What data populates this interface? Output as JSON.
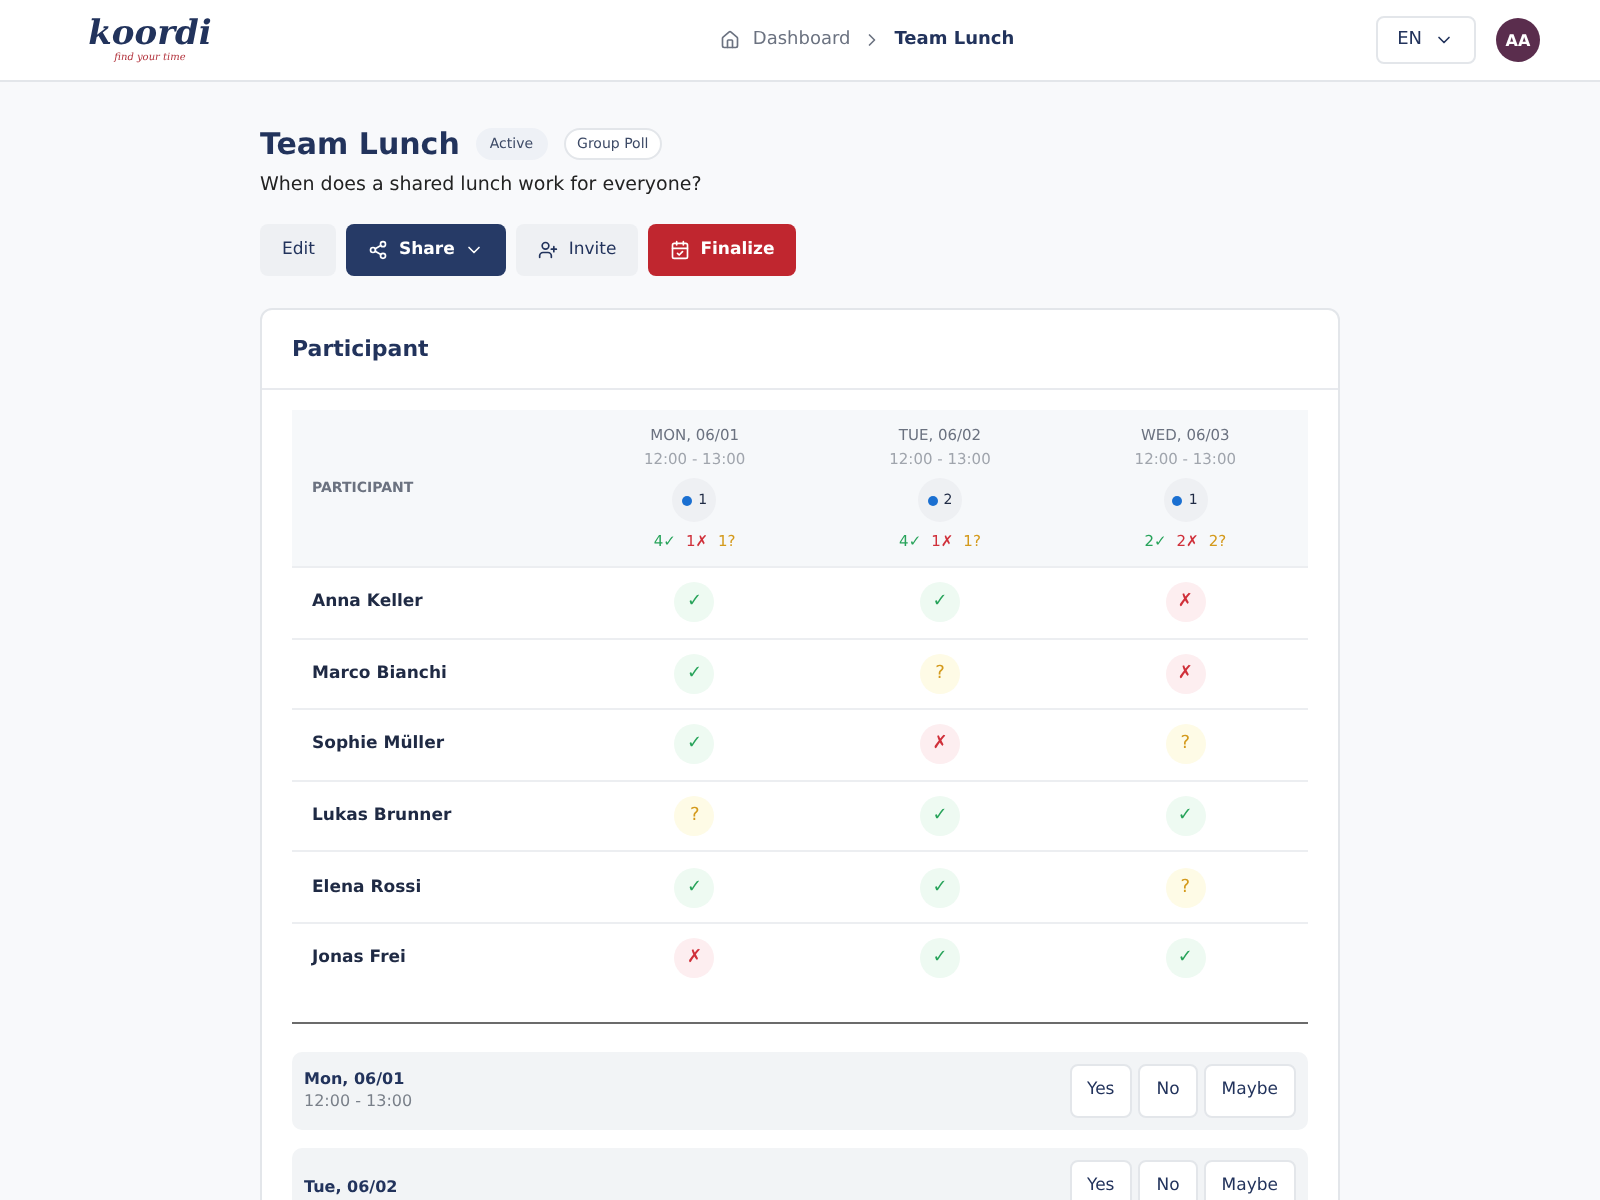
{
  "header": {
    "logo": "koordi",
    "tagline": "find your time",
    "breadcrumb": [
      {
        "label": "Dashboard",
        "current": false
      },
      {
        "label": "Team Lunch",
        "current": true
      }
    ],
    "language": "EN",
    "avatar": "AA"
  },
  "poll": {
    "title": "Team Lunch",
    "badges": [
      {
        "label": "Active",
        "kind": "status"
      },
      {
        "label": "Group Poll",
        "kind": "type"
      }
    ],
    "description": "When does a shared lunch work for everyone?",
    "actions": [
      {
        "label": "Edit",
        "kind": "plain"
      },
      {
        "label": "Share",
        "kind": "primary"
      },
      {
        "label": "Invite",
        "kind": "invite"
      },
      {
        "label": "Finalize",
        "kind": "danger"
      }
    ]
  },
  "card": {
    "title": "Participant"
  },
  "table": {
    "participant_heading": "PARTICIPANT",
    "columns": [
      {
        "day": "MON, 06/01",
        "time": "12:00 - 13:00",
        "count": "1",
        "color": "#1a6fd1",
        "summary": [
          {
            "kind": "yes",
            "text": "4✓"
          },
          {
            "kind": "no",
            "text": "1✗"
          },
          {
            "kind": "maybe",
            "text": "1?"
          }
        ]
      },
      {
        "day": "TUE, 06/02",
        "time": "12:00 - 13:00",
        "count": "2",
        "color": "#1a6fd1",
        "summary": [
          {
            "kind": "yes",
            "text": "4✓"
          },
          {
            "kind": "no",
            "text": "1✗"
          },
          {
            "kind": "maybe",
            "text": "1?"
          }
        ]
      },
      {
        "day": "WED, 06/03",
        "time": "12:00 - 13:00",
        "count": "1",
        "color": "#1a6fd1",
        "summary": [
          {
            "kind": "yes",
            "text": "2✓"
          },
          {
            "kind": "no",
            "text": "2✗"
          },
          {
            "kind": "maybe",
            "text": "2?"
          }
        ]
      }
    ],
    "rows": [
      {
        "name": "Anna Keller",
        "answers": [
          {
            "kind": "yes",
            "symbol": "✓"
          },
          {
            "kind": "yes",
            "symbol": "✓"
          },
          {
            "kind": "no",
            "symbol": "✗"
          }
        ]
      },
      {
        "name": "Marco Bianchi",
        "answers": [
          {
            "kind": "yes",
            "symbol": "✓"
          },
          {
            "kind": "maybe",
            "symbol": "?"
          },
          {
            "kind": "no",
            "symbol": "✗"
          }
        ]
      },
      {
        "name": "Sophie Müller",
        "answers": [
          {
            "kind": "yes",
            "symbol": "✓"
          },
          {
            "kind": "no",
            "symbol": "✗"
          },
          {
            "kind": "maybe",
            "symbol": "?"
          }
        ]
      },
      {
        "name": "Lukas Brunner",
        "answers": [
          {
            "kind": "maybe",
            "symbol": "?"
          },
          {
            "kind": "yes",
            "symbol": "✓"
          },
          {
            "kind": "yes",
            "symbol": "✓"
          }
        ]
      },
      {
        "name": "Elena Rossi",
        "answers": [
          {
            "kind": "yes",
            "symbol": "✓"
          },
          {
            "kind": "yes",
            "symbol": "✓"
          },
          {
            "kind": "maybe",
            "symbol": "?"
          }
        ]
      },
      {
        "name": "Jonas Frei",
        "answers": [
          {
            "kind": "no",
            "symbol": "✗"
          },
          {
            "kind": "yes",
            "symbol": "✓"
          },
          {
            "kind": "yes",
            "symbol": "✓"
          }
        ]
      }
    ]
  },
  "slots": [
    {
      "day": "Mon, 06/01",
      "time": "12:00 - 13:00",
      "options": [
        "Yes",
        "No",
        "Maybe"
      ]
    },
    {
      "day": "Tue, 06/02",
      "options": [
        "Yes",
        "No",
        "Maybe"
      ]
    }
  ]
}
